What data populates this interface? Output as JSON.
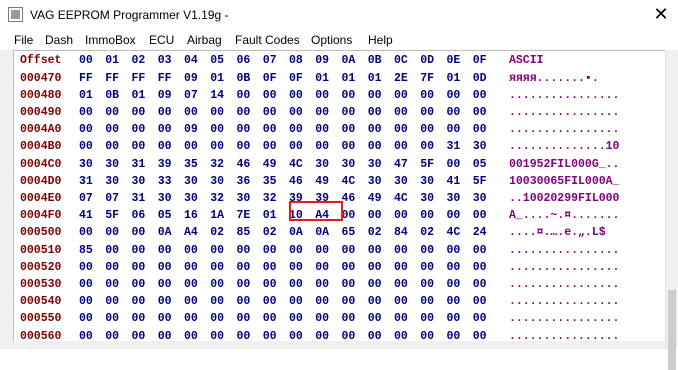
{
  "window": {
    "title": "VAG EEPROM Programmer  V1.19g -",
    "close_glyph": "✕"
  },
  "menu": [
    "File",
    "Dash",
    "ImmoBox",
    "ECU",
    "Airbag",
    "Fault Codes",
    "Options",
    "Help"
  ],
  "header": {
    "offset_label": "Offset",
    "columns": [
      "00",
      "01",
      "02",
      "03",
      "04",
      "05",
      "06",
      "07",
      "08",
      "09",
      "0A",
      "0B",
      "0C",
      "0D",
      "0E",
      "0F"
    ],
    "ascii_label": "ASCII"
  },
  "rows": [
    {
      "offset": "000470",
      "bytes": [
        "FF",
        "FF",
        "FF",
        "FF",
        "09",
        "01",
        "0B",
        "0F",
        "0F",
        "01",
        "01",
        "01",
        "2E",
        "7F",
        "01",
        "0D"
      ],
      "ascii": "яяяя.......▪."
    },
    {
      "offset": "000480",
      "bytes": [
        "01",
        "0B",
        "01",
        "09",
        "07",
        "14",
        "00",
        "00",
        "00",
        "00",
        "00",
        "00",
        "00",
        "00",
        "00",
        "00"
      ],
      "ascii": "................"
    },
    {
      "offset": "000490",
      "bytes": [
        "00",
        "00",
        "00",
        "00",
        "00",
        "00",
        "00",
        "00",
        "00",
        "00",
        "00",
        "00",
        "00",
        "00",
        "00",
        "00"
      ],
      "ascii": "................"
    },
    {
      "offset": "0004A0",
      "bytes": [
        "00",
        "00",
        "00",
        "00",
        "09",
        "00",
        "00",
        "00",
        "00",
        "00",
        "00",
        "00",
        "00",
        "00",
        "00",
        "00"
      ],
      "ascii": "................"
    },
    {
      "offset": "0004B0",
      "bytes": [
        "00",
        "00",
        "00",
        "00",
        "00",
        "00",
        "00",
        "00",
        "00",
        "00",
        "00",
        "00",
        "00",
        "00",
        "31",
        "30"
      ],
      "ascii": "..............10"
    },
    {
      "offset": "0004C0",
      "bytes": [
        "30",
        "30",
        "31",
        "39",
        "35",
        "32",
        "46",
        "49",
        "4C",
        "30",
        "30",
        "30",
        "47",
        "5F",
        "00",
        "05"
      ],
      "ascii": "001952FIL000G_.."
    },
    {
      "offset": "0004D0",
      "bytes": [
        "31",
        "30",
        "30",
        "33",
        "30",
        "30",
        "36",
        "35",
        "46",
        "49",
        "4C",
        "30",
        "30",
        "30",
        "41",
        "5F"
      ],
      "ascii": "10030065FIL000A_"
    },
    {
      "offset": "0004E0",
      "bytes": [
        "07",
        "07",
        "31",
        "30",
        "30",
        "32",
        "30",
        "32",
        "39",
        "39",
        "46",
        "49",
        "4C",
        "30",
        "30",
        "30"
      ],
      "ascii": "..10020299FIL000"
    },
    {
      "offset": "0004F0",
      "bytes": [
        "41",
        "5F",
        "06",
        "05",
        "16",
        "1A",
        "7E",
        "01",
        "10",
        "A4",
        "00",
        "00",
        "00",
        "00",
        "00",
        "00"
      ],
      "ascii": "A_....~.¤......."
    },
    {
      "offset": "000500",
      "bytes": [
        "00",
        "00",
        "00",
        "0A",
        "A4",
        "02",
        "85",
        "02",
        "0A",
        "0A",
        "65",
        "02",
        "84",
        "02",
        "4C",
        "24"
      ],
      "ascii": "....¤.….e.„.L$"
    },
    {
      "offset": "000510",
      "bytes": [
        "85",
        "00",
        "00",
        "00",
        "00",
        "00",
        "00",
        "00",
        "00",
        "00",
        "00",
        "00",
        "00",
        "00",
        "00",
        "00"
      ],
      "ascii": "................"
    },
    {
      "offset": "000520",
      "bytes": [
        "00",
        "00",
        "00",
        "00",
        "00",
        "00",
        "00",
        "00",
        "00",
        "00",
        "00",
        "00",
        "00",
        "00",
        "00",
        "00"
      ],
      "ascii": "................"
    },
    {
      "offset": "000530",
      "bytes": [
        "00",
        "00",
        "00",
        "00",
        "00",
        "00",
        "00",
        "00",
        "00",
        "00",
        "00",
        "00",
        "00",
        "00",
        "00",
        "00"
      ],
      "ascii": "................"
    },
    {
      "offset": "000540",
      "bytes": [
        "00",
        "00",
        "00",
        "00",
        "00",
        "00",
        "00",
        "00",
        "00",
        "00",
        "00",
        "00",
        "00",
        "00",
        "00",
        "00"
      ],
      "ascii": "................"
    },
    {
      "offset": "000550",
      "bytes": [
        "00",
        "00",
        "00",
        "00",
        "00",
        "00",
        "00",
        "00",
        "00",
        "00",
        "00",
        "00",
        "00",
        "00",
        "00",
        "00"
      ],
      "ascii": "................"
    },
    {
      "offset": "000560",
      "bytes": [
        "00",
        "00",
        "00",
        "00",
        "00",
        "00",
        "00",
        "00",
        "00",
        "00",
        "00",
        "00",
        "00",
        "00",
        "00",
        "00"
      ],
      "ascii": "................"
    }
  ],
  "highlight": {
    "row_offset": "0004F0",
    "columns": [
      "08",
      "09"
    ],
    "bytes": [
      "10",
      "A4"
    ]
  },
  "colors": {
    "offset": "#800000",
    "hex": "#000080",
    "ascii": "#800080",
    "highlight_border": "#e21b1b"
  }
}
